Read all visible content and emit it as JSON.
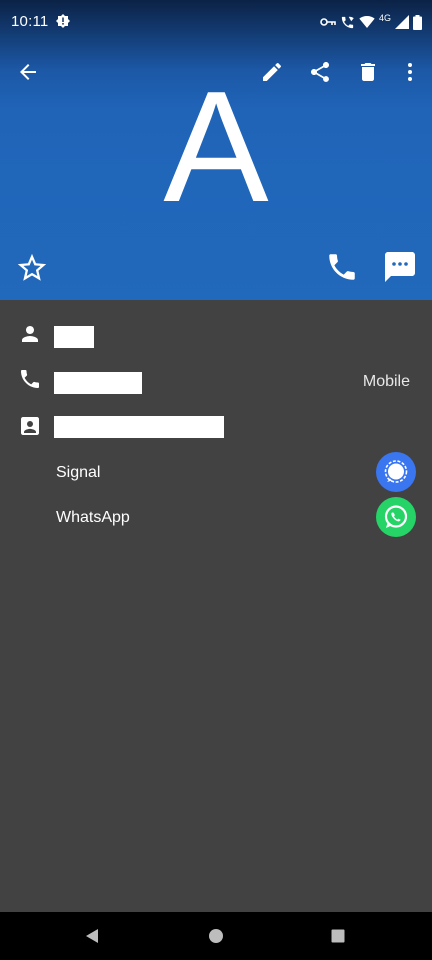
{
  "status": {
    "time": "10:11",
    "network_label": "4G"
  },
  "toolbar": {
    "back_icon": "arrow-back-icon",
    "edit_icon": "pencil-icon",
    "share_icon": "share-icon",
    "delete_icon": "trash-icon",
    "more_icon": "more-vert-icon"
  },
  "contact": {
    "avatar_letter": "A",
    "phone_type": "Mobile"
  },
  "apps": [
    {
      "label": "Signal",
      "icon": "signal-icon",
      "color": "#3a76f0"
    },
    {
      "label": "WhatsApp",
      "icon": "whatsapp-icon",
      "color": "#25d366"
    }
  ],
  "colors": {
    "header": "#2169bb",
    "body": "#424242",
    "navbar": "#000000"
  }
}
